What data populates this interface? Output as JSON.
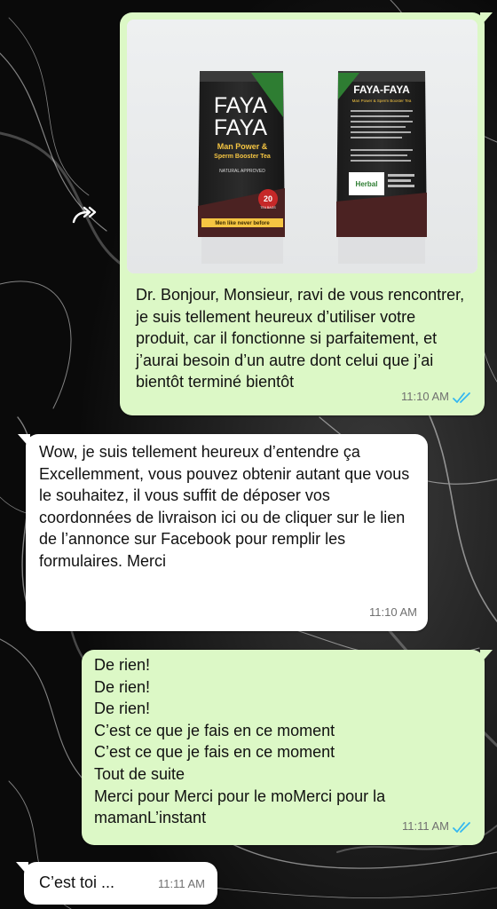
{
  "messages": [
    {
      "direction": "outgoing",
      "has_image": true,
      "image": {
        "front_pack": {
          "brand_line1": "FAYA",
          "brand_line2": "FAYA",
          "subtitle_line1": "Man Power &",
          "subtitle_line2": "Sperm Booster Tea",
          "tagline": "NATURAL APPROVED",
          "count": "20",
          "count_unit": "TEA BAGS",
          "footer": "Men like never before"
        },
        "back_pack": {
          "brand": "FAYA-FAYA",
          "subtitle": "Man Power & Sperm Booster Tea",
          "logo_text": "Herbal"
        }
      },
      "text": "Dr. Bonjour, Monsieur, ravi de vous rencontrer, je suis tellement heureux d’utiliser votre produit, car il fonctionne si parfaitement, et j’aurai besoin d’un autre dont celui que j’ai bientôt terminé bientôt",
      "time": "11:10 AM",
      "status": "read"
    },
    {
      "direction": "incoming",
      "text": "Wow, je suis tellement heureux d’entendre ça\nExcellemment, vous pouvez obtenir autant que vous le souhaitez, il vous suffit de déposer vos coordonnées de livraison ici ou de cliquer sur le lien de l’annonce sur Facebook pour remplir les formulaires. Merci",
      "time": "11:10 AM"
    },
    {
      "direction": "outgoing",
      "text": "De rien!\nDe rien!\nDe rien!\nC’est ce que je fais en ce moment\nC’est ce que je fais en ce moment\nTout de suite\nMerci pour Merci pour le moMerci pour la mamanL’instant",
      "time": "11:11 AM",
      "status": "read"
    },
    {
      "direction": "incoming",
      "text": "C’est toi ...",
      "time": "11:11 AM"
    }
  ],
  "icons": {
    "forward": "forward-double-arrow-icon",
    "read_receipt": "double-check-icon"
  },
  "colors": {
    "outgoing_bubble": "#dcf8c6",
    "incoming_bubble": "#ffffff",
    "read_ticks": "#34b7f1",
    "meta_text": "#707070",
    "background": "#0c0c0c"
  }
}
